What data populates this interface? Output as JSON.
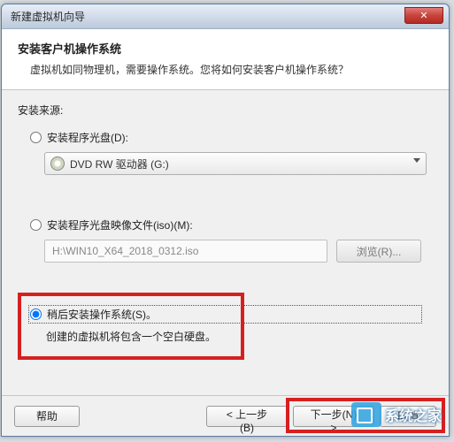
{
  "window": {
    "title": "新建虚拟机向导"
  },
  "header": {
    "title": "安装客户机操作系统",
    "subtitle": "虚拟机如同物理机，需要操作系统。您将如何安装客户机操作系统？"
  },
  "body": {
    "source_label": "安装来源:",
    "opt_disc": {
      "label": "安装程序光盘(D):",
      "drive": "DVD RW 驱动器 (G:)",
      "selected": false
    },
    "opt_iso": {
      "label": "安装程序光盘映像文件(iso)(M):",
      "path": "H:\\WIN10_X64_2018_0312.iso",
      "browse": "浏览(R)...",
      "selected": false
    },
    "opt_later": {
      "label": "稍后安装操作系统(S)。",
      "desc": "创建的虚拟机将包含一个空白硬盘。",
      "selected": true
    }
  },
  "footer": {
    "help": "帮助",
    "back": "< 上一步(B)",
    "next": "下一步(N) >",
    "cancel": "取消"
  },
  "watermark": "系统之家"
}
